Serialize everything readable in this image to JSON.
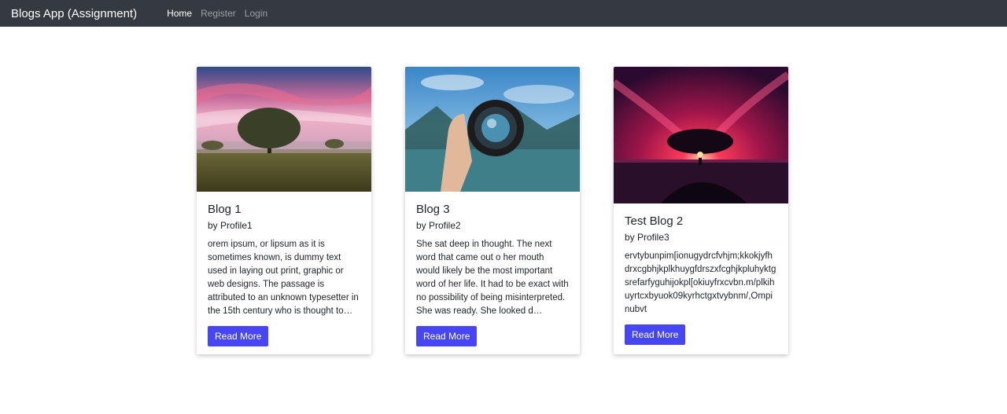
{
  "navbar": {
    "brand": "Blogs App (Assignment)",
    "links": [
      {
        "label": "Home",
        "active": true
      },
      {
        "label": "Register",
        "active": false
      },
      {
        "label": "Login",
        "active": false
      }
    ]
  },
  "cards": [
    {
      "title": "Blog 1",
      "author": "by Profile1",
      "excerpt": "orem ipsum, or lipsum as it is sometimes known, is dummy text used in laying out print, graphic or web designs. The passage is attributed to an unknown typesetter in the 15th century who is thought to have scr…",
      "button": "Read More",
      "image": "tree-at-sunset-meadow"
    },
    {
      "title": "Blog 3",
      "author": "by Profile2",
      "excerpt": "She sat deep in thought. The next word that came out o her mouth would likely be the most important word of her life. It had to be exact with no possibility of being misinterpreted. She was ready. She looked d…",
      "button": "Read More",
      "image": "hand-holding-camera-lens"
    },
    {
      "title": "Test Blog 2",
      "author": "by Profile3",
      "excerpt": "ervtybunpim[ionugydrcfvhjm;kkokjyfhdrxcgbhjkplkhuygfdrszxfcghjkpluhyktgsrefarfyguhijokpl[okiuyfrxcvbn.m/plkihuyrtcxbyuok09kyrhctgxtvybnm/,Ompinubvt",
      "button": "Read More",
      "image": "lone-tree-red-sky"
    }
  ]
}
